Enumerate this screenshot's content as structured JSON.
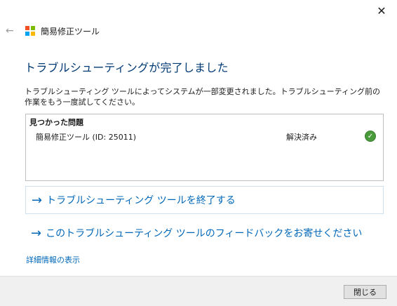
{
  "window": {
    "close_symbol": "✕",
    "back_symbol": "←",
    "app_title": "簡易修正ツール",
    "logo_colors": [
      "#f25022",
      "#7fba00",
      "#00a4ef",
      "#ffb900"
    ]
  },
  "main": {
    "heading": "トラブルシューティングが完了しました",
    "description": "トラブルシューティング ツールによってシステムが一部変更されました。トラブルシューティング前の作業をもう一度試してください。"
  },
  "problems": {
    "header": "見つかった問題",
    "items": [
      {
        "name": "簡易修正ツール (ID: 25011)",
        "status": "解決済み",
        "status_icon": "check-circle-icon",
        "status_symbol": "✓",
        "status_color": "#4a9b3c"
      }
    ]
  },
  "actions": {
    "arrow_symbol": "→",
    "close_troubleshooter": "トラブルシューティング ツールを終了する",
    "send_feedback": "このトラブルシューティング ツールのフィードバックをお寄せください",
    "details": "詳細情報の表示"
  },
  "footer": {
    "close_button": "閉じる"
  },
  "colors": {
    "link": "#0067b8",
    "heading": "#003a75"
  }
}
